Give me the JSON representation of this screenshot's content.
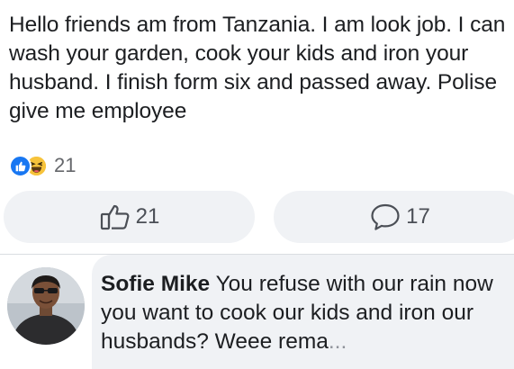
{
  "post": {
    "text": "Hello friends am from Tanzania. I am look job. I can wash your garden, cook your kids and iron your husband. I finish form six and passed away. Polise give me employee"
  },
  "reactions": {
    "icons": [
      "like-icon",
      "haha-icon"
    ],
    "count": "21"
  },
  "actions": {
    "like_count": "21",
    "comment_count": "17"
  },
  "comment": {
    "author": "Sofie Mike",
    "text": "You refuse with our rain now you want to cook our kids and iron our husbands? Weee rema",
    "see_more": "..."
  },
  "colors": {
    "accent": "#1877f2",
    "haha": "#f7c33b",
    "button_bg": "#f0f2f5",
    "muted_text": "#65676b"
  }
}
